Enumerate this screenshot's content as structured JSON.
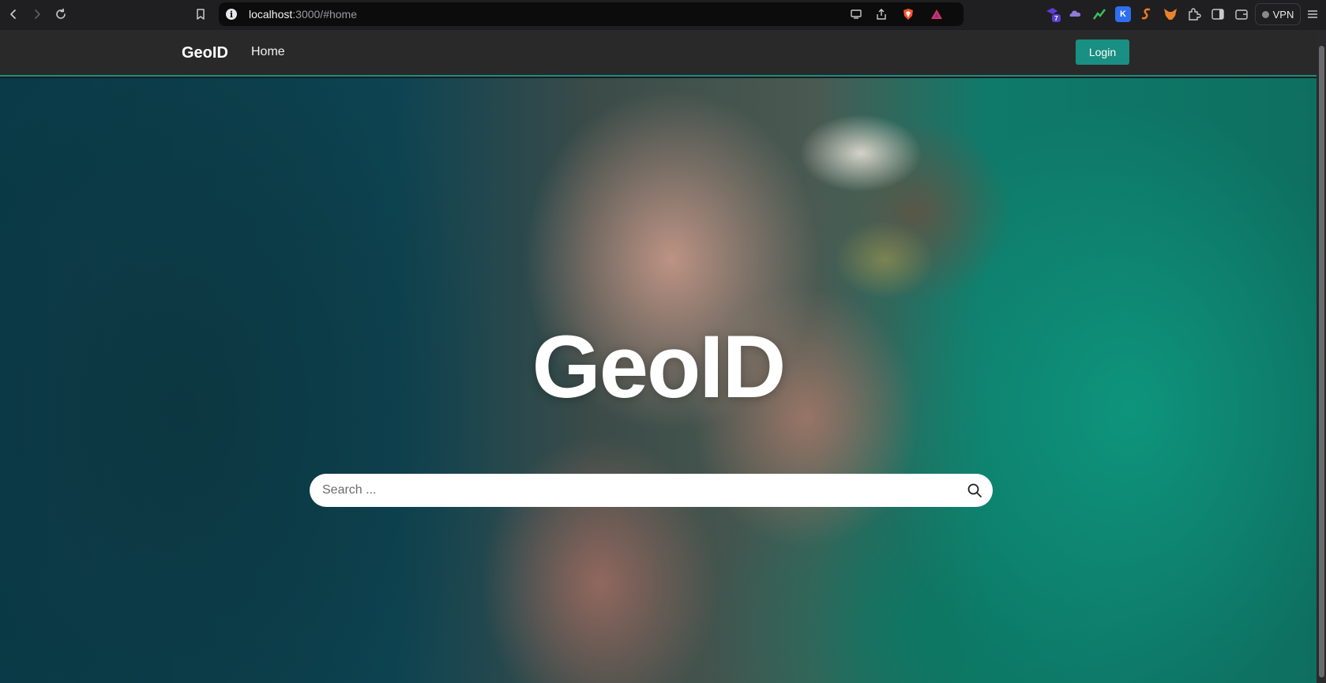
{
  "browser": {
    "url_host": "localhost",
    "url_path": ":3000/#home",
    "extensions": [
      {
        "name": "extension-badge",
        "badge": "7",
        "color": "#5b3fd0"
      },
      {
        "name": "extension-cloud",
        "color": "#8f7bd8"
      },
      {
        "name": "extension-chart",
        "color": "#3cc05c"
      },
      {
        "name": "extension-k",
        "label": "K",
        "color": "#2f6ef0"
      },
      {
        "name": "extension-s",
        "color": "#f07a1e"
      },
      {
        "name": "extension-fox",
        "color": "#e8822c"
      }
    ],
    "vpn_label": "VPN"
  },
  "navbar": {
    "brand": "GeoID",
    "home": "Home",
    "login": "Login"
  },
  "hero": {
    "title": "GeoID",
    "search_placeholder": "Search ..."
  },
  "colors": {
    "accent": "#1a8f83",
    "navbar_bg": "#292929"
  }
}
